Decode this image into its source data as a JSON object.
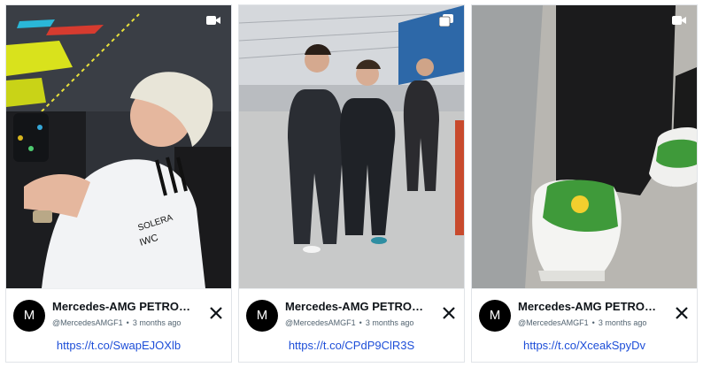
{
  "cards": [
    {
      "media": {
        "type": "video",
        "badge_icon": "video-camera-icon"
      },
      "author": {
        "avatar_initial": "M",
        "name": "Mercedes-AMG PETRONAS F...",
        "handle": "@MercedesAMGF1",
        "time": "3 months ago"
      },
      "platform_icon": "x-logo-icon",
      "link": "https://t.co/SwapEJOXlb"
    },
    {
      "media": {
        "type": "gallery",
        "badge_icon": "gallery-icon"
      },
      "author": {
        "avatar_initial": "M",
        "name": "Mercedes-AMG PETRONAS F...",
        "handle": "@MercedesAMGF1",
        "time": "3 months ago"
      },
      "platform_icon": "x-logo-icon",
      "link": "https://t.co/CPdP9ClR3S"
    },
    {
      "media": {
        "type": "video",
        "badge_icon": "video-camera-icon"
      },
      "author": {
        "avatar_initial": "M",
        "name": "Mercedes-AMG PETRONAS F...",
        "handle": "@MercedesAMGF1",
        "time": "3 months ago"
      },
      "platform_icon": "x-logo-icon",
      "link": "https://t.co/XceakSpyDv"
    }
  ],
  "colors": {
    "link": "#1d4ed8",
    "meta": "#536471",
    "border": "#e1e4e8"
  }
}
